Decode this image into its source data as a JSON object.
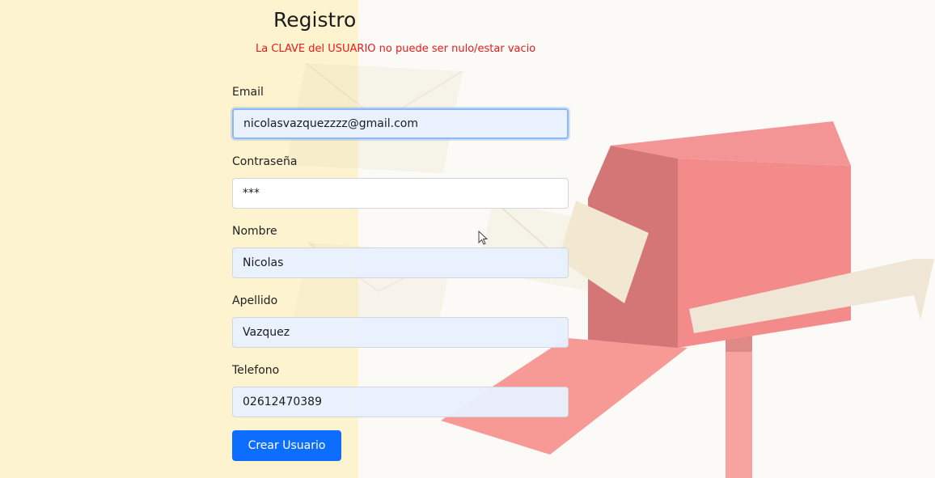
{
  "title": "Registro",
  "error_message": "La CLAVE del USUARIO no puede ser nulo/estar vacio",
  "form": {
    "email": {
      "label": "Email",
      "value": "nicolasvazquezzzz@gmail.com"
    },
    "password": {
      "label": "Contraseña",
      "value": "***"
    },
    "nombre": {
      "label": "Nombre",
      "value": "Nicolas"
    },
    "apellido": {
      "label": "Apellido",
      "value": "Vazquez"
    },
    "telefono": {
      "label": "Telefono",
      "value": "02612470389"
    }
  },
  "submit_label": "Crear Usuario",
  "colors": {
    "accent": "#0d6efd",
    "error": "#e61b1b",
    "left_panel": "#fdf3cf",
    "mailbox": "#f48b8b"
  },
  "icons": {
    "cursor": "mouse-pointer-icon",
    "illustration": "mailbox-illustration"
  }
}
